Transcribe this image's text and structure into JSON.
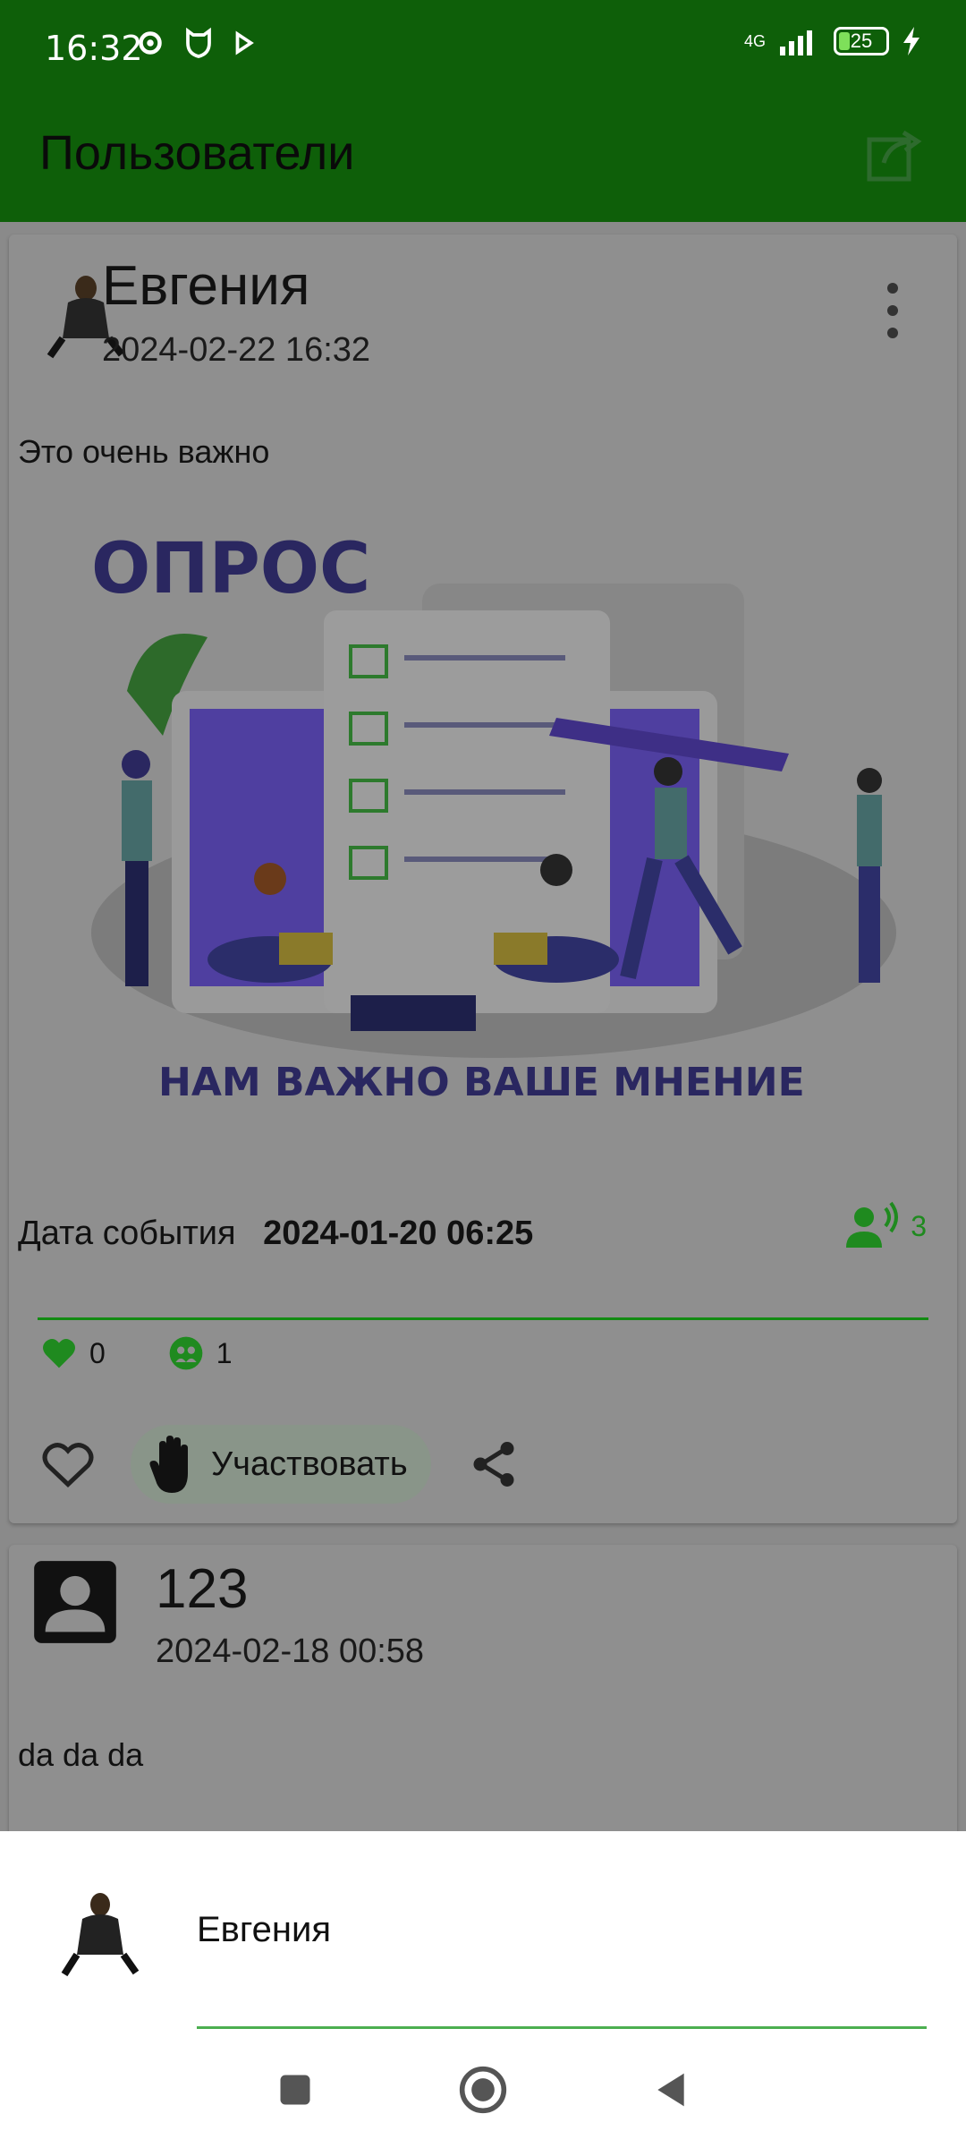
{
  "status": {
    "time": "16:32",
    "network": "4G",
    "battery": "25"
  },
  "appbar": {
    "title": "Пользователи"
  },
  "posts": [
    {
      "author": "Евгения",
      "datetime": "2024-02-22 16:32",
      "text": "Это очень важно",
      "image": {
        "heading": "ОПРОС",
        "caption": "НАМ ВАЖНО ВАШЕ МНЕНИЕ"
      },
      "event_label": "Дата события",
      "event_date": "2024-01-20 06:25",
      "participants": "3",
      "likes": "0",
      "members": "1",
      "participate_label": "Участвовать"
    },
    {
      "author": "123",
      "datetime": "2024-02-18 00:58",
      "text": "da da da"
    }
  ],
  "sheet": {
    "name": "Евгения"
  },
  "colors": {
    "primary": "#0e5f09",
    "accent": "#1f8a1f",
    "line": "#4caf50"
  }
}
